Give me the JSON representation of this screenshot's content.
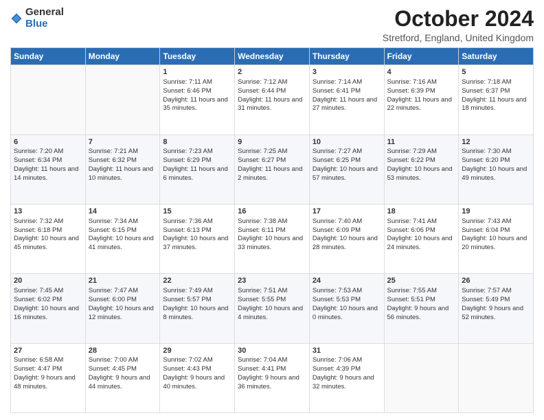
{
  "header": {
    "logo_general": "General",
    "logo_blue": "Blue",
    "month_title": "October 2024",
    "location": "Stretford, England, United Kingdom"
  },
  "days_of_week": [
    "Sunday",
    "Monday",
    "Tuesday",
    "Wednesday",
    "Thursday",
    "Friday",
    "Saturday"
  ],
  "weeks": [
    [
      {
        "day": "",
        "info": ""
      },
      {
        "day": "",
        "info": ""
      },
      {
        "day": "1",
        "info": "Sunrise: 7:11 AM\nSunset: 6:46 PM\nDaylight: 11 hours and 35 minutes."
      },
      {
        "day": "2",
        "info": "Sunrise: 7:12 AM\nSunset: 6:44 PM\nDaylight: 11 hours and 31 minutes."
      },
      {
        "day": "3",
        "info": "Sunrise: 7:14 AM\nSunset: 6:41 PM\nDaylight: 11 hours and 27 minutes."
      },
      {
        "day": "4",
        "info": "Sunrise: 7:16 AM\nSunset: 6:39 PM\nDaylight: 11 hours and 22 minutes."
      },
      {
        "day": "5",
        "info": "Sunrise: 7:18 AM\nSunset: 6:37 PM\nDaylight: 11 hours and 18 minutes."
      }
    ],
    [
      {
        "day": "6",
        "info": "Sunrise: 7:20 AM\nSunset: 6:34 PM\nDaylight: 11 hours and 14 minutes."
      },
      {
        "day": "7",
        "info": "Sunrise: 7:21 AM\nSunset: 6:32 PM\nDaylight: 11 hours and 10 minutes."
      },
      {
        "day": "8",
        "info": "Sunrise: 7:23 AM\nSunset: 6:29 PM\nDaylight: 11 hours and 6 minutes."
      },
      {
        "day": "9",
        "info": "Sunrise: 7:25 AM\nSunset: 6:27 PM\nDaylight: 11 hours and 2 minutes."
      },
      {
        "day": "10",
        "info": "Sunrise: 7:27 AM\nSunset: 6:25 PM\nDaylight: 10 hours and 57 minutes."
      },
      {
        "day": "11",
        "info": "Sunrise: 7:29 AM\nSunset: 6:22 PM\nDaylight: 10 hours and 53 minutes."
      },
      {
        "day": "12",
        "info": "Sunrise: 7:30 AM\nSunset: 6:20 PM\nDaylight: 10 hours and 49 minutes."
      }
    ],
    [
      {
        "day": "13",
        "info": "Sunrise: 7:32 AM\nSunset: 6:18 PM\nDaylight: 10 hours and 45 minutes."
      },
      {
        "day": "14",
        "info": "Sunrise: 7:34 AM\nSunset: 6:15 PM\nDaylight: 10 hours and 41 minutes."
      },
      {
        "day": "15",
        "info": "Sunrise: 7:36 AM\nSunset: 6:13 PM\nDaylight: 10 hours and 37 minutes."
      },
      {
        "day": "16",
        "info": "Sunrise: 7:38 AM\nSunset: 6:11 PM\nDaylight: 10 hours and 33 minutes."
      },
      {
        "day": "17",
        "info": "Sunrise: 7:40 AM\nSunset: 6:09 PM\nDaylight: 10 hours and 28 minutes."
      },
      {
        "day": "18",
        "info": "Sunrise: 7:41 AM\nSunset: 6:06 PM\nDaylight: 10 hours and 24 minutes."
      },
      {
        "day": "19",
        "info": "Sunrise: 7:43 AM\nSunset: 6:04 PM\nDaylight: 10 hours and 20 minutes."
      }
    ],
    [
      {
        "day": "20",
        "info": "Sunrise: 7:45 AM\nSunset: 6:02 PM\nDaylight: 10 hours and 16 minutes."
      },
      {
        "day": "21",
        "info": "Sunrise: 7:47 AM\nSunset: 6:00 PM\nDaylight: 10 hours and 12 minutes."
      },
      {
        "day": "22",
        "info": "Sunrise: 7:49 AM\nSunset: 5:57 PM\nDaylight: 10 hours and 8 minutes."
      },
      {
        "day": "23",
        "info": "Sunrise: 7:51 AM\nSunset: 5:55 PM\nDaylight: 10 hours and 4 minutes."
      },
      {
        "day": "24",
        "info": "Sunrise: 7:53 AM\nSunset: 5:53 PM\nDaylight: 10 hours and 0 minutes."
      },
      {
        "day": "25",
        "info": "Sunrise: 7:55 AM\nSunset: 5:51 PM\nDaylight: 9 hours and 56 minutes."
      },
      {
        "day": "26",
        "info": "Sunrise: 7:57 AM\nSunset: 5:49 PM\nDaylight: 9 hours and 52 minutes."
      }
    ],
    [
      {
        "day": "27",
        "info": "Sunrise: 6:58 AM\nSunset: 4:47 PM\nDaylight: 9 hours and 48 minutes."
      },
      {
        "day": "28",
        "info": "Sunrise: 7:00 AM\nSunset: 4:45 PM\nDaylight: 9 hours and 44 minutes."
      },
      {
        "day": "29",
        "info": "Sunrise: 7:02 AM\nSunset: 4:43 PM\nDaylight: 9 hours and 40 minutes."
      },
      {
        "day": "30",
        "info": "Sunrise: 7:04 AM\nSunset: 4:41 PM\nDaylight: 9 hours and 36 minutes."
      },
      {
        "day": "31",
        "info": "Sunrise: 7:06 AM\nSunset: 4:39 PM\nDaylight: 9 hours and 32 minutes."
      },
      {
        "day": "",
        "info": ""
      },
      {
        "day": "",
        "info": ""
      }
    ]
  ]
}
